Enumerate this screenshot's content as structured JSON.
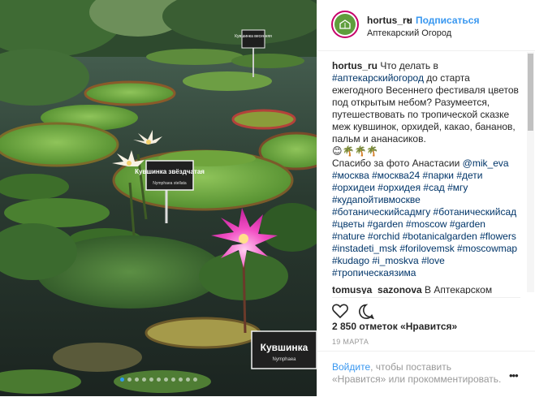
{
  "photo": {
    "sign_top": "Кувшинка весенняя",
    "sign_mid": "Кувшинка звёздчатая",
    "sign_mid_sub": "Nymphaea stellata",
    "sign_bottom": "Кувшинка",
    "sign_bottom_sub": "Nymphaea",
    "carousel_count": 11,
    "carousel_active": 0
  },
  "header": {
    "username": "hortus_ru",
    "separator": "•",
    "follow_label": "Подписаться",
    "location": "Аптекарский Огород"
  },
  "caption": {
    "user": "hortus_ru",
    "p1": " Что делать в ",
    "tag1": "#аптекарскийогород",
    "p2": " до старта ежегодного Весеннего фестиваля цветов под открытым небом? Разумеется, путешествовать по тропической сказке меж кувшинок, орхидей, какао, бананов, пальм и ананасиков.",
    "emoji": "😊🌴🌴🌴",
    "credit": "Спасибо за фото Анастасии ",
    "credit_user": "@mik_eva",
    "hashtags": "#москва #москва24 #парки #дети #орхидеи #орхидея #сад #мгу #кудапойтивмоскве #ботаническийсадмгу #ботаническийсад #цветы #garden #moscow #garden #nature #orchid #botanicalgarden #flowers #instadeti_msk #forilovemsk #moscowmap #kudago #i_moskva #love #тропическаязима"
  },
  "comment2": {
    "user": "tomusya_sazonova",
    "text": " В Аптекарском огороде всегда есть, чем полюбоваться!"
  },
  "likes": "2 850 отметок «Нравится»",
  "date": "19 МАРТА",
  "footer": {
    "login_link": "Войдите",
    "login_text": ", чтобы поставить «Нравится» или прокомментировать.",
    "more": "•••"
  }
}
